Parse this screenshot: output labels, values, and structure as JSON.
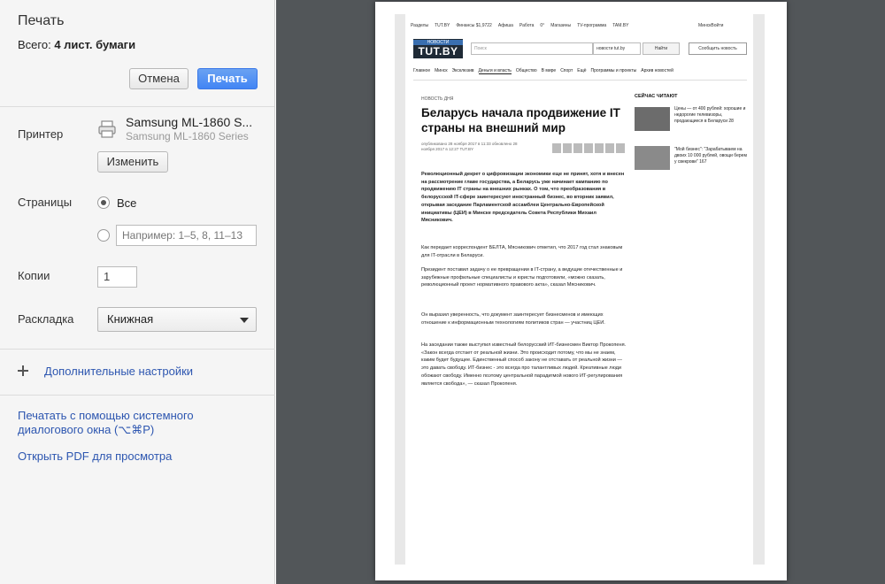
{
  "dialog": {
    "title": "Печать",
    "total_prefix": "Всего: ",
    "total_value": "4 лист. бумаги",
    "cancel_label": "Отмена",
    "print_label": "Печать"
  },
  "printer": {
    "label": "Принтер",
    "name": "Samsung ML-1860 S...",
    "subname": "Samsung ML-1860 Series",
    "change_label": "Изменить"
  },
  "pages": {
    "label": "Страницы",
    "option_all": "Все",
    "custom_placeholder": "Например: 1–5, 8, 11–13"
  },
  "copies": {
    "label": "Копии",
    "value": "1"
  },
  "layout": {
    "label": "Раскладка",
    "selected": "Книжная"
  },
  "more_settings_label": "Дополнительные настройки",
  "links": {
    "system_dialog_line1": "Печатать с помощью системного",
    "system_dialog_line2": "диалогового окна (⌥⌘P)",
    "open_pdf": "Открыть PDF для просмотра"
  },
  "preview": {
    "topnav": [
      "Разделы",
      "TUT.BY",
      "Финансы $1,9722",
      "Афиша",
      "Работа",
      "0°",
      "Магазины",
      "TV-программа",
      "TAM.BY"
    ],
    "topnav_right": [
      "Минск",
      "Войти"
    ],
    "logo_small": "НОВОСТИ",
    "logo_big": "TUT.BY",
    "search_placeholder": "Поиск",
    "search_select": "новости tut.by",
    "search_button": "Найти",
    "news_button": "Сообщить новость",
    "menu": [
      "Главное",
      "Минск",
      "Эксклюзив",
      "Деньги и власть",
      "Общество",
      "В мире",
      "Спорт",
      "Ещё",
      "Программы и проекты",
      "Архив новостей"
    ],
    "kicker": "НОВОСТЬ ДНЯ",
    "headline": "Беларусь начала продвижение IT страны на внешний мир",
    "meta": "опубликовано 28 ноября 2017 в 11:33 обновлено 28 ноября 2017 в 12:27 TUT.BY",
    "lead": "Революционный декрет о цифровизации экономики еще не принят, хотя и внесен на рассмотрение главе государства, а Беларусь уже начинает кампанию по продвижению IT страны на внешних рынках. О том, что преобразования в белорусской IT-сфере заинтересуют иностранный бизнес, во вторник заявил, открывая заседание Парламентской ассамблеи Центрально-Европейской инициативы (ЦЕИ) в Минске председатель Совета Республики Михаил Мясникович.",
    "p1": "Как передает корреспондент БЕЛТА, Мясникович отметил, что 2017 год стал знаковым для IT-отрасли в Беларуси.",
    "p2": "Президент поставил задачу о ее превращении в IT-страну, а ведущие отечественные и зарубежные профильные специалисты и юристы подготовили, «можно сказать, революционный проект нормативного правового акта», сказал Мясникович.",
    "p3": "Он выразил уверенность, что документ заинтересует бизнесменов и имеющих отношение к информационным технологиям политиков стран — участниц ЦЕИ.",
    "p4": "На заседании также выступил известный белорусский ИТ-бизнесмен Виктор Прокопеня. «Закон всегда отстает от реальной жизни. Это происходит потому, что мы не знаем, каким будет будущее. Единственный способ закону не отставать от реальной жизни — это давать свободу. ИТ-бизнес - это всегда про талантливых людей. Креативные люди обожают свободу. Именно поэтому центральной парадигмой нового ИТ-регулирования является свобода», — сказал Прокопеня.",
    "side_title": "СЕЙЧАС ЧИТАЮТ",
    "side_1": "Цены — от 400 рублей: хорошие и недорогие телевизоры, продающиеся в Беларуси 28",
    "side_2": "\"Мой бизнес\": \"Зарабатываем на двоих 10 000 рублей, овощи берем у свекрови\" 167"
  }
}
